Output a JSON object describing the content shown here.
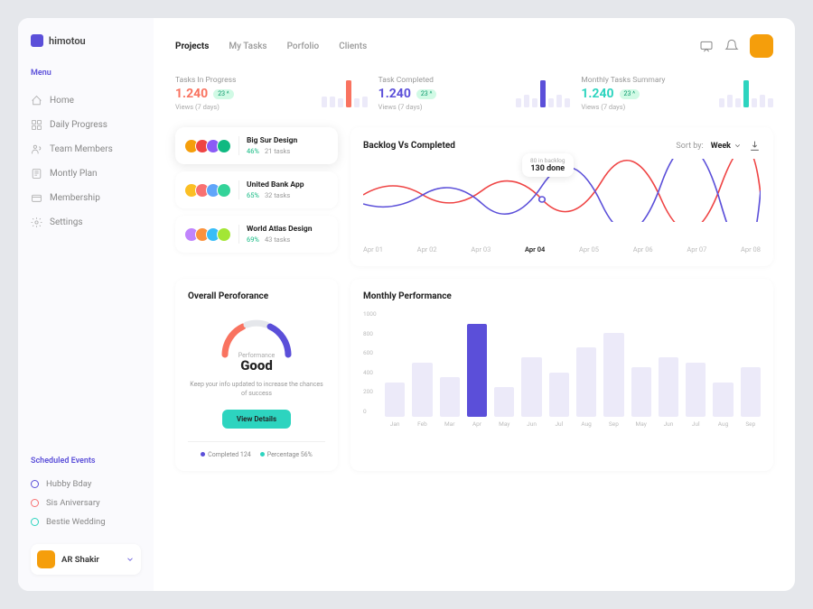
{
  "brand": "himotou",
  "sidebar": {
    "menu_label": "Menu",
    "items": [
      {
        "label": "Home"
      },
      {
        "label": "Daily Progress"
      },
      {
        "label": "Team Members"
      },
      {
        "label": "Montly Plan"
      },
      {
        "label": "Membership"
      },
      {
        "label": "Settings"
      }
    ],
    "events_label": "Scheduled Events",
    "events": [
      {
        "label": "Hubby Bday",
        "color": "#5b4fd9"
      },
      {
        "label": "Sis Aniversary",
        "color": "#f87171"
      },
      {
        "label": "Bestie Wedding",
        "color": "#2dd4bf"
      }
    ],
    "user": {
      "name": "AR Shakir"
    }
  },
  "tabs": [
    "Projects",
    "My Tasks",
    "Porfolio",
    "Clients"
  ],
  "active_tab": 0,
  "stats": [
    {
      "title": "Tasks In Progress",
      "value": "1.240",
      "delta": "23 ^",
      "sub": "Views (7 days)",
      "accent": "#f97360",
      "bars": [
        12,
        12,
        10,
        30,
        10,
        12
      ]
    },
    {
      "title": "Task Completed",
      "value": "1.240",
      "delta": "23 ^",
      "sub": "Views (7 days)",
      "accent": "#5b4fd9",
      "bars": [
        10,
        14,
        10,
        30,
        10,
        14,
        10
      ]
    },
    {
      "title": "Monthly Tasks Summary",
      "value": "1.240",
      "delta": "23 ^",
      "sub": "Views (7 days)",
      "accent": "#2dd4bf",
      "bars": [
        10,
        14,
        10,
        30,
        10,
        14,
        10
      ]
    }
  ],
  "projects": [
    {
      "name": "Big Sur Design",
      "pct": "46%",
      "tasks": "21 tasks",
      "colors": [
        "#f59e0b",
        "#ef4444",
        "#8b5cf6",
        "#10b981"
      ]
    },
    {
      "name": "United Bank App",
      "pct": "65%",
      "tasks": "32 tasks",
      "colors": [
        "#fbbf24",
        "#f87171",
        "#60a5fa",
        "#34d399"
      ]
    },
    {
      "name": "World Atlas Design",
      "pct": "69%",
      "tasks": "43 tasks",
      "colors": [
        "#c084fc",
        "#fb923c",
        "#38bdf8",
        "#a3e635"
      ]
    }
  ],
  "backlog_chart": {
    "title": "Backlog Vs Completed",
    "sort_label": "Sort by:",
    "sort_value": "Week",
    "tooltip": {
      "sub": "80 in backlog",
      "main": "130 done"
    },
    "xaxis": [
      "Apr 01",
      "Apr 02",
      "Apr 03",
      "Apr 04",
      "Apr 05",
      "Apr 06",
      "Apr 07",
      "Apr 08"
    ],
    "active_x": 3
  },
  "performance": {
    "title": "Overall Peroforance",
    "label": "Performance",
    "value": "Good",
    "desc": "Keep your info updated to increase the chances of success",
    "btn": "View Details",
    "legend": [
      {
        "label": "Completed 124",
        "color": "#5b4fd9"
      },
      {
        "label": "Percentage 56%",
        "color": "#2dd4bf"
      }
    ]
  },
  "monthly": {
    "title": "Monthly Performance",
    "yticks": [
      "1000",
      "800",
      "600",
      "400",
      "200",
      "0"
    ],
    "bars": [
      {
        "label": "Jan",
        "v": 350
      },
      {
        "label": "Feb",
        "v": 550
      },
      {
        "label": "Mar",
        "v": 400
      },
      {
        "label": "Apr",
        "v": 940,
        "active": true
      },
      {
        "label": "May",
        "v": 300
      },
      {
        "label": "Jun",
        "v": 600
      },
      {
        "label": "Jul",
        "v": 450
      },
      {
        "label": "Aug",
        "v": 700
      },
      {
        "label": "Sep",
        "v": 850
      },
      {
        "label": "May",
        "v": 500
      },
      {
        "label": "Jun",
        "v": 600
      },
      {
        "label": "Jul",
        "v": 550
      },
      {
        "label": "Aug",
        "v": 350
      },
      {
        "label": "Sep",
        "v": 500
      }
    ]
  },
  "chart_data": [
    {
      "type": "bar",
      "title": "Tasks In Progress sparkline",
      "values": [
        12,
        12,
        10,
        30,
        10,
        12
      ]
    },
    {
      "type": "bar",
      "title": "Task Completed sparkline",
      "values": [
        10,
        14,
        10,
        30,
        10,
        14,
        10
      ]
    },
    {
      "type": "bar",
      "title": "Monthly Tasks Summary sparkline",
      "values": [
        10,
        14,
        10,
        30,
        10,
        14,
        10
      ]
    },
    {
      "type": "line",
      "title": "Backlog Vs Completed",
      "categories": [
        "Apr 01",
        "Apr 02",
        "Apr 03",
        "Apr 04",
        "Apr 05",
        "Apr 06",
        "Apr 07",
        "Apr 08"
      ],
      "series": [
        {
          "name": "Backlog",
          "values": [
            90,
            70,
            110,
            80,
            60,
            120,
            80,
            110
          ]
        },
        {
          "name": "Done",
          "values": [
            60,
            110,
            70,
            130,
            100,
            70,
            125,
            75
          ]
        }
      ],
      "annotations": [
        {
          "x": "Apr 04",
          "text": "80 in backlog / 130 done"
        }
      ]
    },
    {
      "type": "bar",
      "title": "Monthly Performance",
      "ylim": [
        0,
        1000
      ],
      "categories": [
        "Jan",
        "Feb",
        "Mar",
        "Apr",
        "May",
        "Jun",
        "Jul",
        "Aug",
        "Sep",
        "May",
        "Jun",
        "Jul",
        "Aug",
        "Sep"
      ],
      "values": [
        350,
        550,
        400,
        940,
        300,
        600,
        450,
        700,
        850,
        500,
        600,
        550,
        350,
        500
      ]
    }
  ]
}
